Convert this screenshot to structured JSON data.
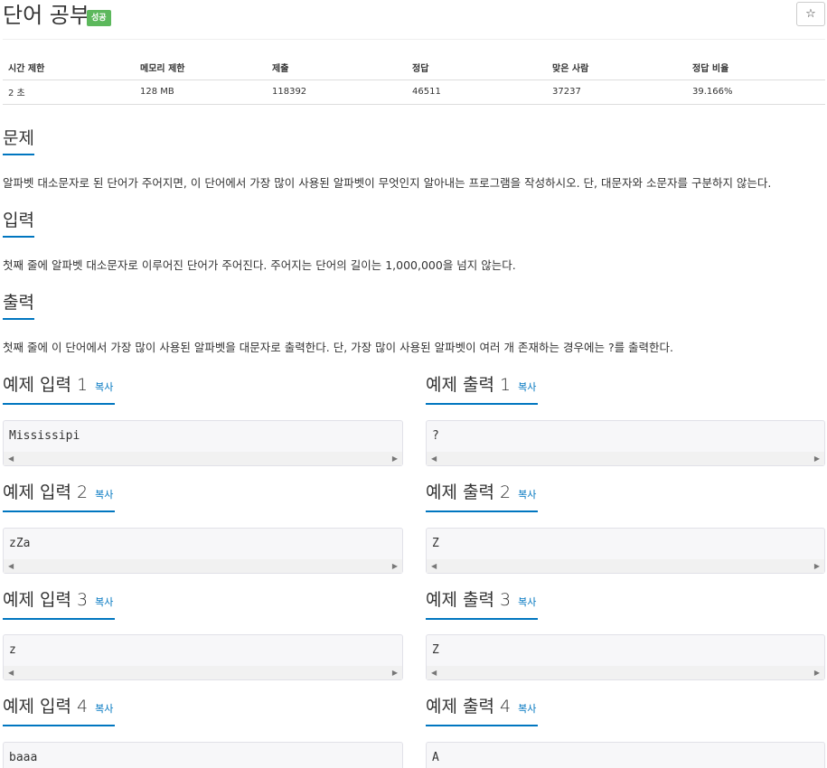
{
  "title": "단어 공부",
  "badge": "성공",
  "star_icon": "☆",
  "info": {
    "headers": [
      "시간 제한",
      "메모리 제한",
      "제출",
      "정답",
      "맞은 사람",
      "정답 비율"
    ],
    "values": [
      "2 초",
      "128 MB",
      "118392",
      "46511",
      "37237",
      "39.166%"
    ]
  },
  "sections": {
    "problem": {
      "heading": "문제",
      "text": "알파벳 대소문자로 된 단어가 주어지면, 이 단어에서 가장 많이 사용된 알파벳이 무엇인지 알아내는 프로그램을 작성하시오. 단, 대문자와 소문자를 구분하지 않는다."
    },
    "input": {
      "heading": "입력",
      "text": "첫째 줄에 알파벳 대소문자로 이루어진 단어가 주어진다. 주어지는 단어의 길이는 1,000,000을 넘지 않는다."
    },
    "output": {
      "heading": "출력",
      "text": "첫째 줄에 이 단어에서 가장 많이 사용된 알파벳을 대문자로 출력한다. 단, 가장 많이 사용된 알파벳이 여러 개 존재하는 경우에는 ?를 출력한다."
    }
  },
  "copy_label": "복사",
  "examples": [
    {
      "input_heading": "예제 입력 1",
      "output_heading": "예제 출력 1",
      "input": "Mississipi",
      "output": "?"
    },
    {
      "input_heading": "예제 입력 2",
      "output_heading": "예제 출력 2",
      "input": "zZa",
      "output": "Z"
    },
    {
      "input_heading": "예제 입력 3",
      "output_heading": "예제 출력 3",
      "input": "z",
      "output": "Z"
    },
    {
      "input_heading": "예제 입력 4",
      "output_heading": "예제 출력 4",
      "input": "baaa",
      "output": "A"
    }
  ],
  "scroll_left_icon": "◀",
  "scroll_right_icon": "▶"
}
